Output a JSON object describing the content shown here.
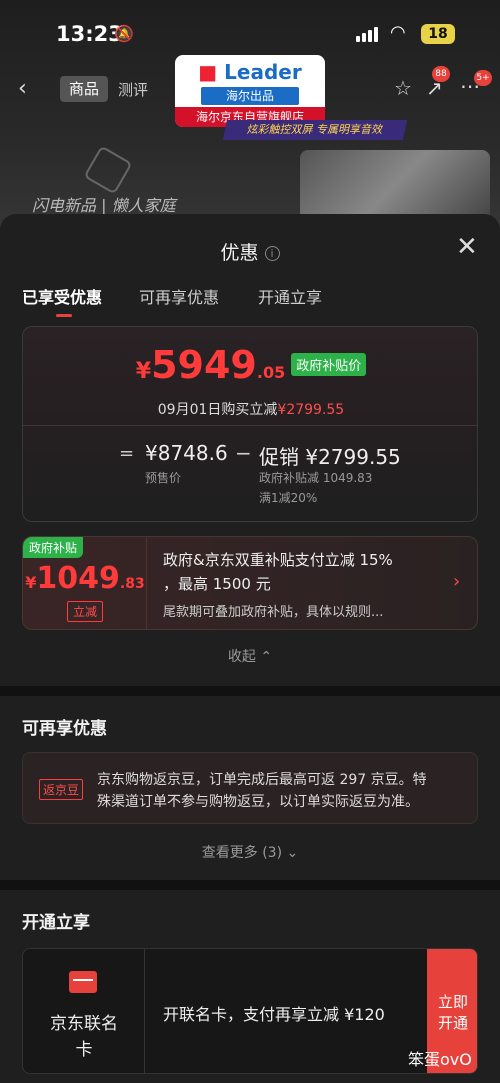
{
  "status_bar": {
    "time": "13:23",
    "battery": "18"
  },
  "nav": {
    "tab_product": "商品",
    "tab_review": "测评",
    "share_badge": "88",
    "more_badge": "5+"
  },
  "brand": {
    "logo": "Leader",
    "line1": "海尔出品",
    "line2": "海尔京东自营旗舰店"
  },
  "banner": {
    "promo": "炫彩触控双屏 专属明享音效",
    "text": "闪电新品 | 懒人家庭"
  },
  "sheet": {
    "title": "优惠",
    "tabs": [
      "已享受优惠",
      "可再享优惠",
      "开通立享"
    ],
    "summary": {
      "currency": "¥",
      "price_int": "5949",
      "price_dec": ".05",
      "gov_tag": "政府补贴价",
      "sub_text": "09月01日购买立减",
      "sub_amount": "¥2799.55",
      "eq": "=",
      "presale_price": "¥8748.6",
      "presale_label": "预售价",
      "minus": "−",
      "promo": "促销 ¥2799.55",
      "promo_detail1": "政府补贴减 1049.83",
      "promo_detail2": "满1减20%"
    },
    "subsidy": {
      "tag": "政府补贴",
      "currency": "¥",
      "amount_int": "1049",
      "amount_dec": ".83",
      "btn": "立减",
      "line1": "政府&京东双重补贴支付立减 15%",
      "line2": "，最高 1500 元",
      "line3": "尾款期可叠加政府补贴，具体以规则..."
    },
    "collapse": "收起 ⌃",
    "more_offers": {
      "title": "可再享优惠",
      "tag": "返京豆",
      "line1": "京东购物返京豆，订单完成后最高可返 297 京豆。特",
      "line2": "殊渠道订单不参与购物返豆，以订单实际返豆为准。",
      "view_more": "查看更多 (3) ⌄"
    },
    "open_now": {
      "title": "开通立享",
      "card_name1": "京东联名",
      "card_name2": "卡",
      "text": "开联名卡，支付再享立减 ¥120",
      "btn1": "立即",
      "btn2": "开通"
    }
  },
  "watermark": "笨蛋ovO"
}
